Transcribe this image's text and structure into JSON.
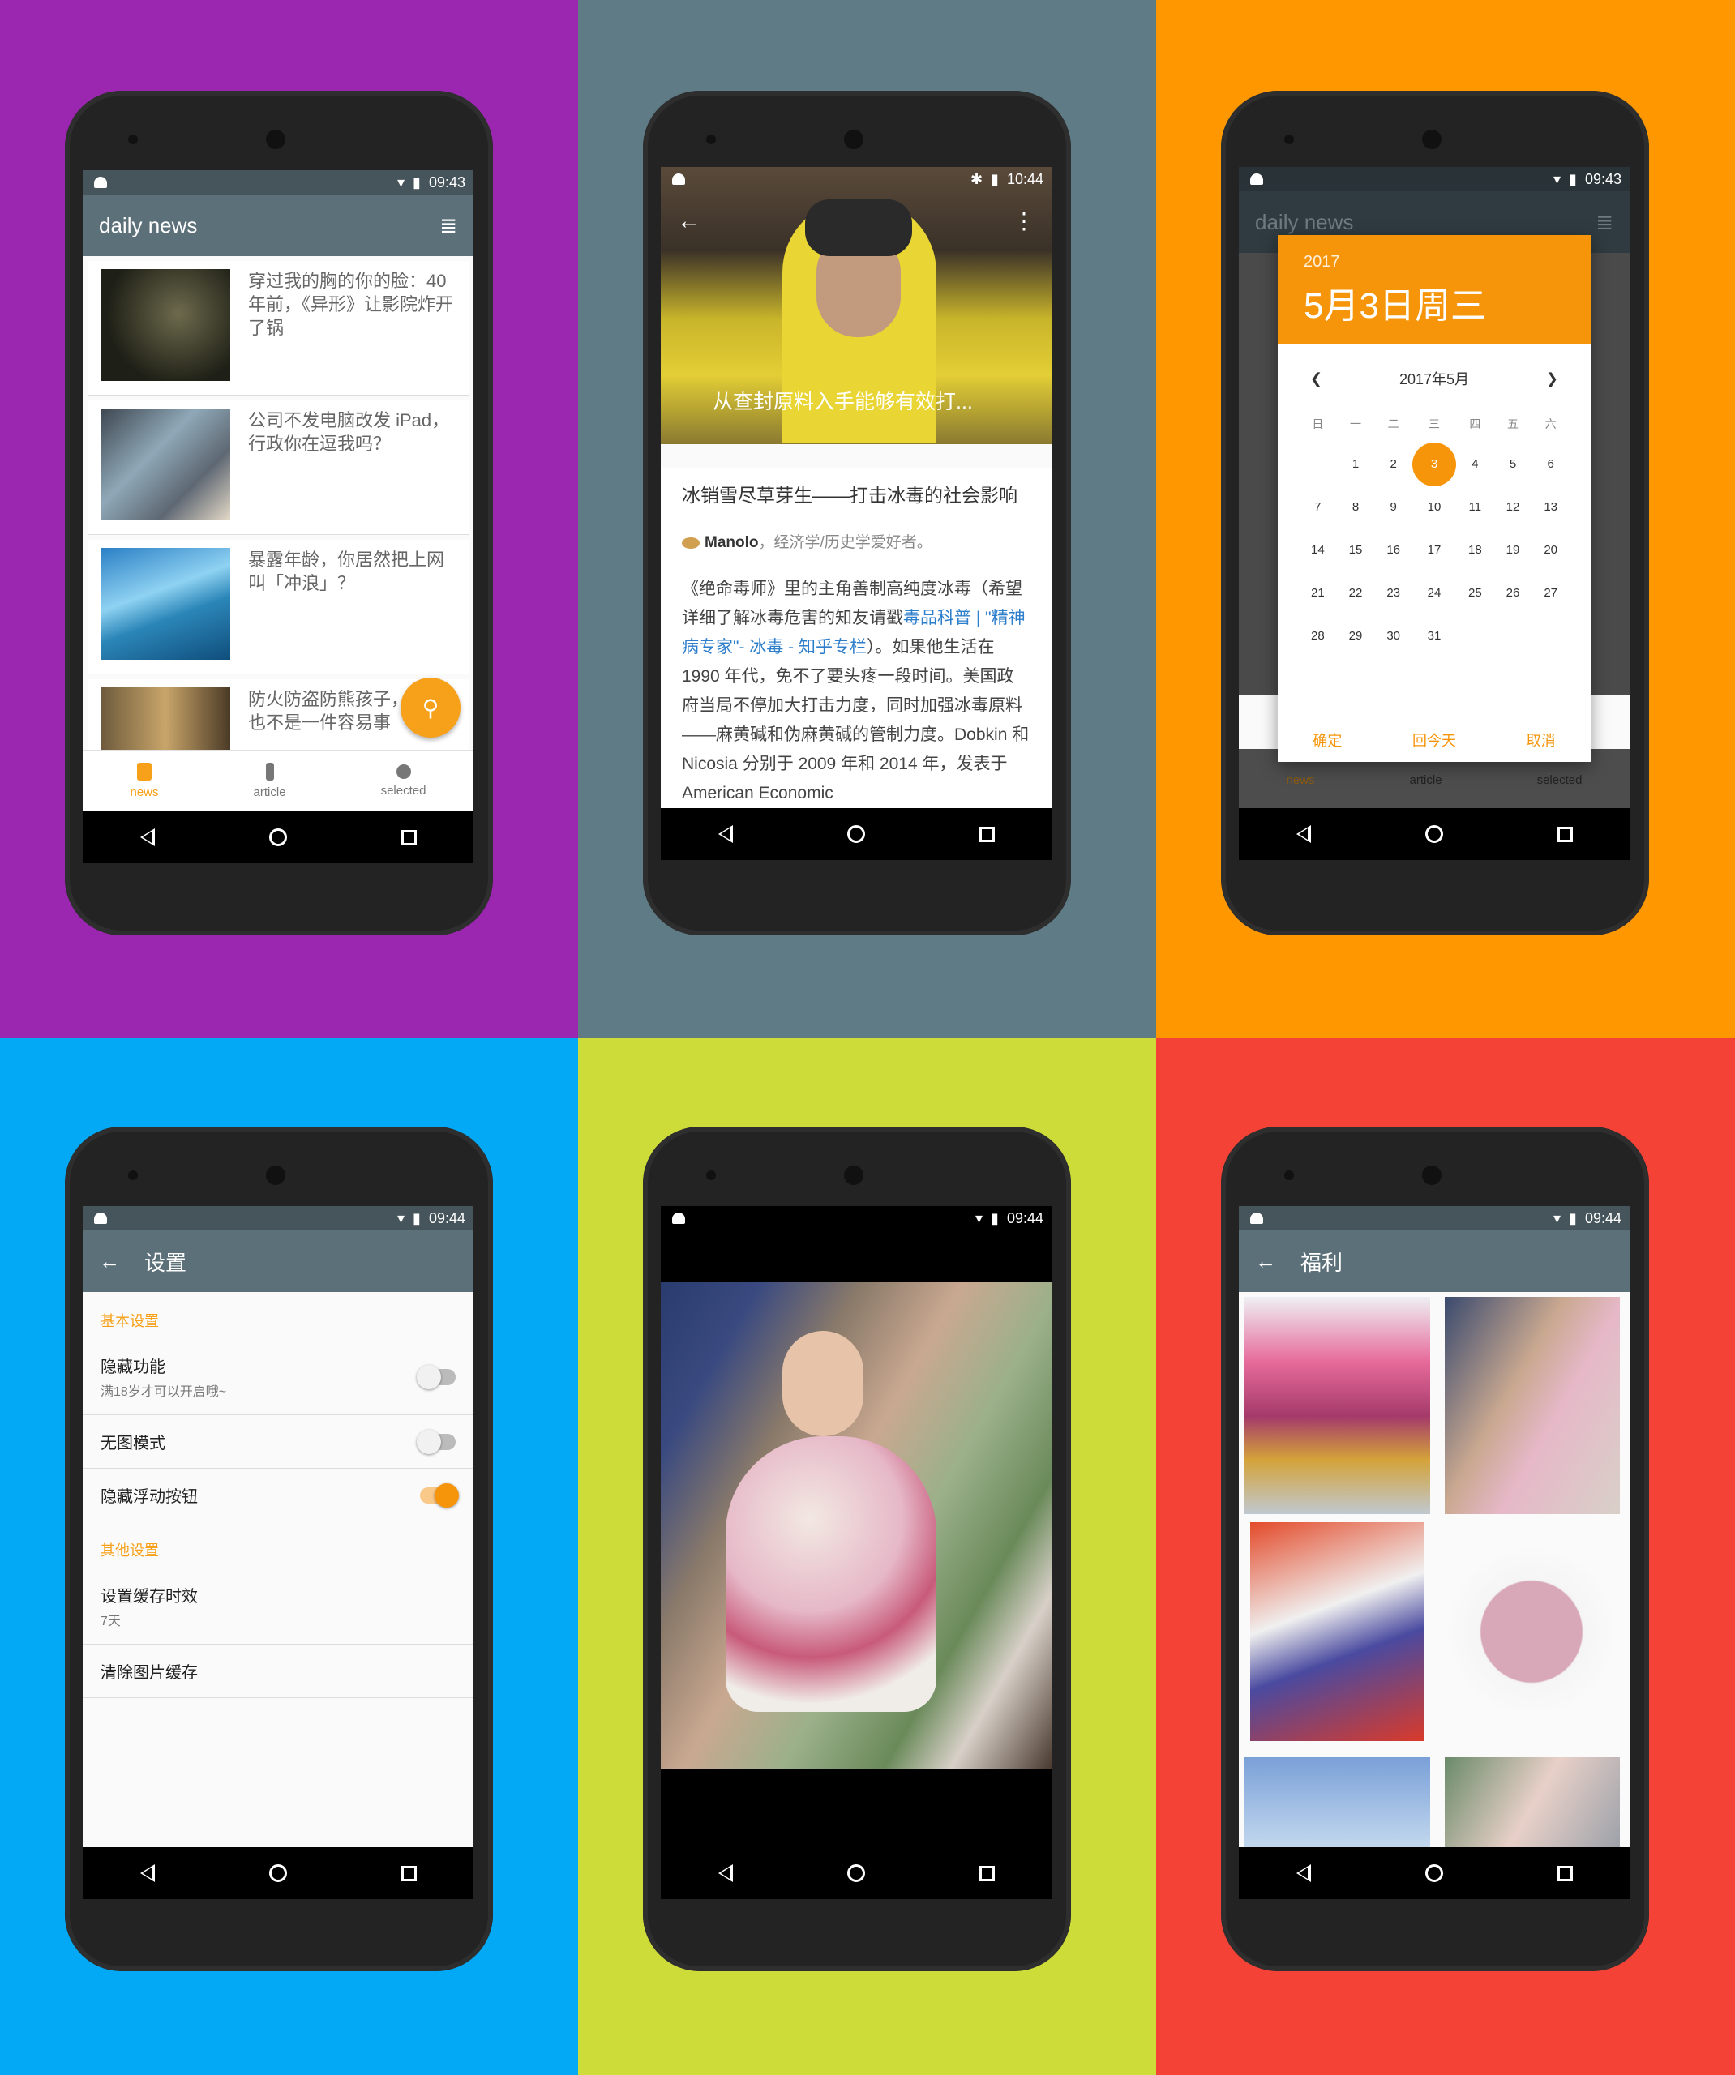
{
  "colors": {
    "purple": "#9b27b0",
    "slate": "#5f7b86",
    "orange": "#ff9800",
    "blue": "#03a9f4",
    "lime": "#cddc39",
    "red": "#f44336",
    "accent": "#f7a11a",
    "appbar": "#5c7079"
  },
  "screen1": {
    "time": "09:43",
    "title": "daily news",
    "news": [
      {
        "title": "穿过我的胸的你的脸：40 年前，《异形》让影院炸开了锅"
      },
      {
        "title": "公司不发电脑改发 iPad，行政你在逗我吗？"
      },
      {
        "title": "暴露年龄，你居然把上网叫「冲浪」？"
      },
      {
        "title": "防火防盗防熊孩子，手办也不是一件容易事"
      }
    ],
    "tabs": {
      "news": "news",
      "article": "article",
      "selected": "selected"
    }
  },
  "screen2": {
    "time": "10:44",
    "hero_title": "从查封原料入手能够有效打...",
    "article_title": "冰销雪尽草芽生——打击冰毒的社会影响",
    "author": "Manolo",
    "author_desc": "，经济学/历史学爱好者。",
    "body_1": "《绝命毒师》里的主角善制高纯度冰毒（希望详细了解冰毒危害的知友请戳",
    "body_link": "毒品科普 | \"精神病专家\"- 冰毒 - 知乎专栏",
    "body_2": "）。如果他生活在 1990 年代，免不了要头疼一段时间。美国政府当局不停加大打击力度，同时加强冰毒原料——麻黄碱和伪麻黄碱的管制力度。Dobkin 和 Nicosia 分别于 2009 年和 2014 年，发表于 American Economic"
  },
  "screen3": {
    "time": "09:43",
    "year": "2017",
    "date": "5月3日周三",
    "month": "2017年5月",
    "weekdays": [
      "日",
      "一",
      "二",
      "三",
      "四",
      "五",
      "六"
    ],
    "days": [
      "",
      "1",
      "2",
      "3",
      "4",
      "5",
      "6",
      "7",
      "8",
      "9",
      "10",
      "11",
      "12",
      "13",
      "14",
      "15",
      "16",
      "17",
      "18",
      "19",
      "20",
      "21",
      "22",
      "23",
      "24",
      "25",
      "26",
      "27",
      "28",
      "29",
      "30",
      "31"
    ],
    "selected_day": "3",
    "ok": "确定",
    "today": "回今天",
    "cancel": "取消",
    "bg_title": "daily news",
    "tabs": {
      "news": "news",
      "article": "article",
      "selected": "selected"
    }
  },
  "screen4": {
    "time": "09:44",
    "title": "设置",
    "section_basic": "基本设置",
    "hide_feature": "隐藏功能",
    "hide_feature_sub": "满18岁才可以开启哦~",
    "no_image": "无图模式",
    "hide_fab": "隐藏浮动按钮",
    "section_other": "其他设置",
    "cache_time": "设置缓存时效",
    "cache_time_sub": "7天",
    "clear_cache": "清除图片缓存",
    "toggles": {
      "hide_feature": false,
      "no_image": false,
      "hide_fab": true
    }
  },
  "screen5": {
    "time": "09:44"
  },
  "screen6": {
    "time": "09:44",
    "title": "福利"
  }
}
